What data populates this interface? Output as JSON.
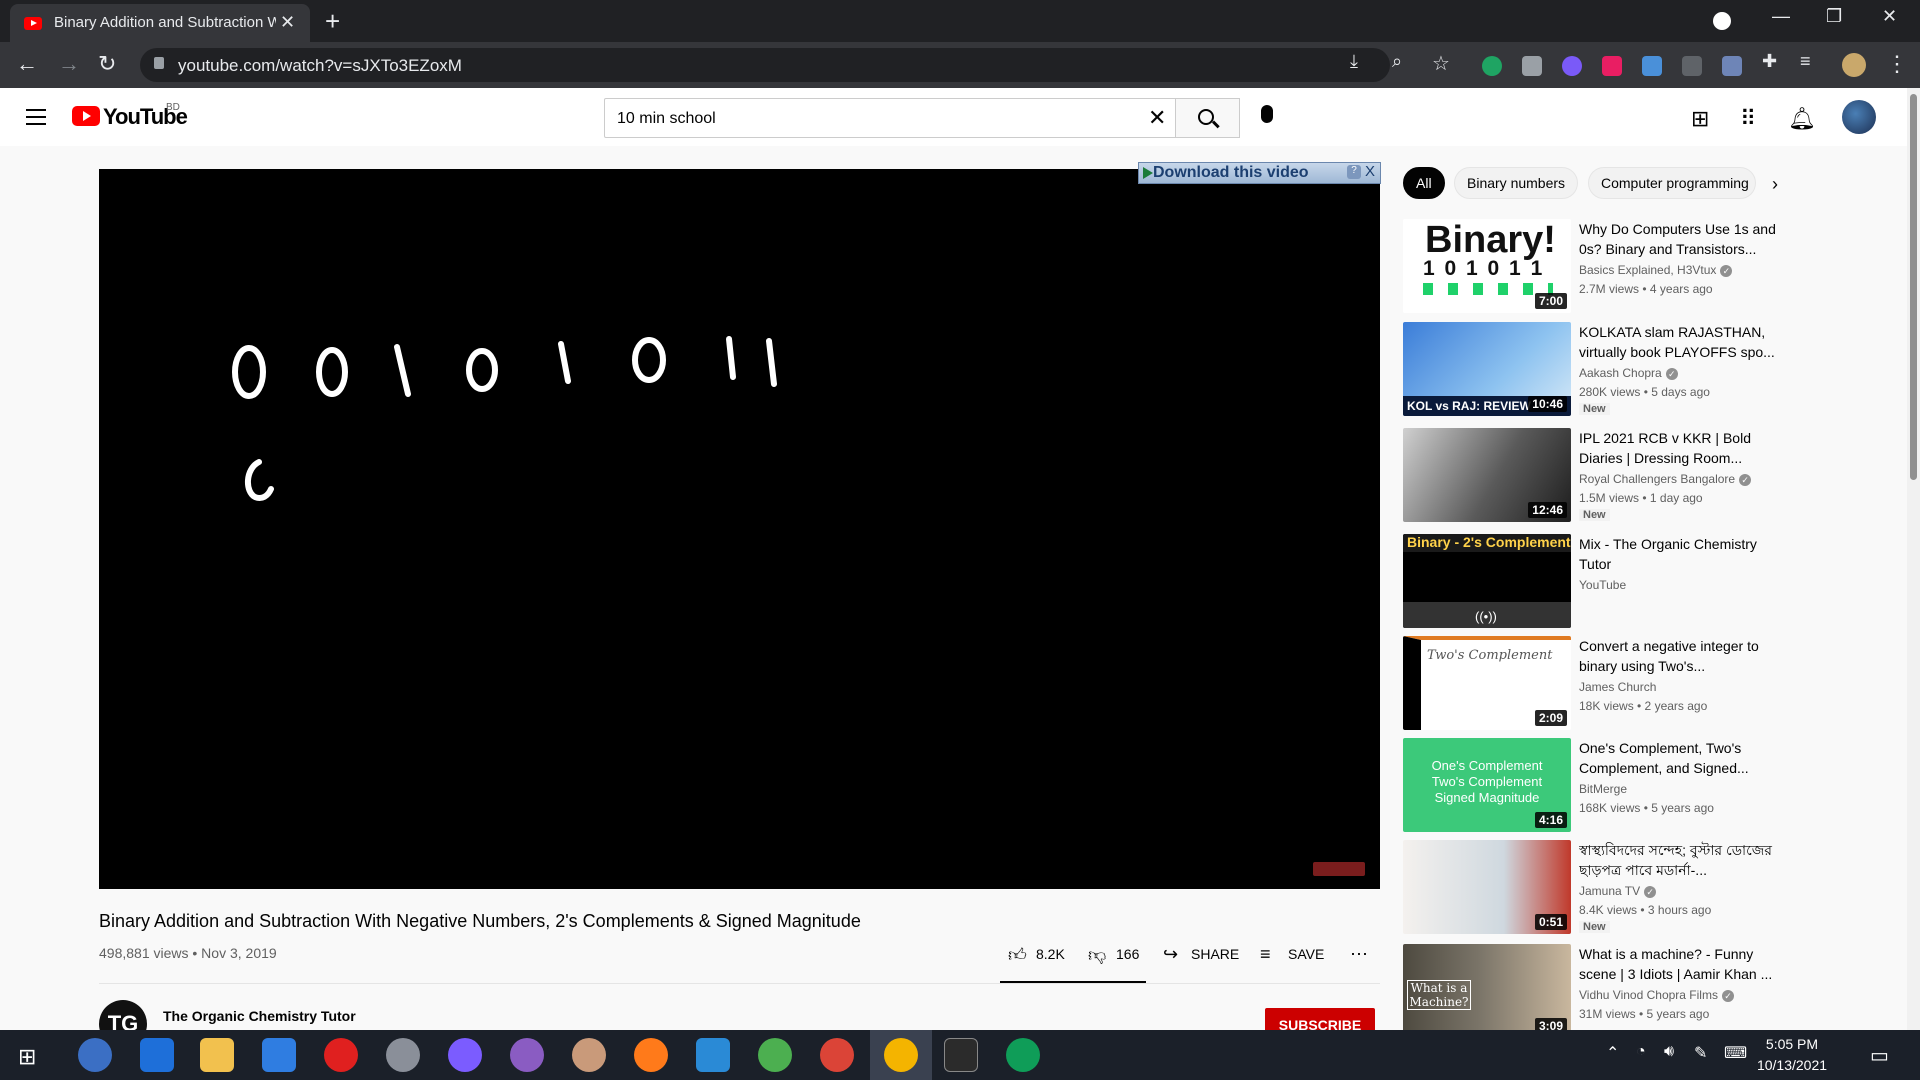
{
  "browser": {
    "tab_title": "Binary Addition and Subtraction With Negative Numbers, 2's Complements & Signed Magnitude - YouTube",
    "url": "youtube.com/watch?v=sJXTo3EZoxM"
  },
  "header": {
    "logo_text": "YouTube",
    "region": "BD",
    "search_value": "10 min school",
    "search_placeholder": "Search"
  },
  "player": {
    "download_label": "Download this video",
    "help": "?",
    "close": "X",
    "board_digits": [
      "0",
      "0",
      "1",
      "0",
      "1",
      "0",
      "1",
      "1"
    ]
  },
  "video": {
    "title": "Binary Addition and Subtraction With Negative Numbers, 2's Complements & Signed Magnitude",
    "meta": "498,881 views • Nov 3, 2019",
    "likes": "8.2K",
    "dislikes": "166",
    "share": "SHARE",
    "save": "SAVE",
    "channel": "The Organic Chemistry Tutor",
    "channel_initials": "TG",
    "subscribe": "SUBSCRIBE"
  },
  "chips": [
    "All",
    "Binary numbers",
    "Computer programming"
  ],
  "recs": [
    {
      "title": "Why Do Computers Use 1s and 0s? Binary and Transistors...",
      "channel": "Basics Explained, H3Vtux",
      "meta": "2.7M views • 4 years ago",
      "duration": "7:00",
      "badge": "",
      "thumb_title": "Binary!",
      "thumb_bits": "1 0 1 0 1 1"
    },
    {
      "title": "KOLKATA slam RAJASTHAN, virtually book PLAYOFFS spo...",
      "channel": "Aakash Chopra",
      "meta": "280K views • 5 days ago",
      "duration": "10:46",
      "badge": "New",
      "thumb_title": "KOL vs RAJ: REVIEW"
    },
    {
      "title": "IPL 2021 RCB v KKR | Bold Diaries | Dressing Room...",
      "channel": "Royal Challengers Bangalore",
      "meta": "1.5M views • 1 day ago",
      "duration": "12:46",
      "badge": "New"
    },
    {
      "title": "Mix - The Organic Chemistry Tutor",
      "channel": "YouTube",
      "meta": "",
      "duration": "",
      "badge": "",
      "thumb_title": "Binary - 2's Complement"
    },
    {
      "title": "Convert a negative integer to binary using Two's...",
      "channel": "James Church",
      "meta": "18K views • 2 years ago",
      "duration": "2:09",
      "badge": "",
      "thumb_title": "Two's Complement"
    },
    {
      "title": "One's Complement, Two's Complement, and Signed...",
      "channel": "BitMerge",
      "meta": "168K views • 5 years ago",
      "duration": "4:16",
      "badge": "",
      "thumb_title": "One's Complement Two's Complement Signed Magnitude"
    },
    {
      "title": "স্বাস্থ্যবিদদের সন্দেহ; বুস্টার ডোজের ছাড়পত্র পাবে মডার্না-...",
      "channel": "Jamuna TV",
      "meta": "8.4K views • 3 hours ago",
      "duration": "0:51",
      "badge": "New"
    },
    {
      "title": "What is a machine? - Funny scene | 3 Idiots | Aamir Khan ...",
      "channel": "Vidhu Vinod Chopra Films",
      "meta": "31M views • 5 years ago",
      "duration": "3:09",
      "badge": "",
      "thumb_title": "What is a Machine?"
    }
  ],
  "taskbar": {
    "time": "5:05 PM",
    "date": "10/13/2021"
  },
  "colors": {
    "yt_red": "#ff0000",
    "subscribe_red": "#cc0000",
    "chrome_dark": "#202124"
  }
}
